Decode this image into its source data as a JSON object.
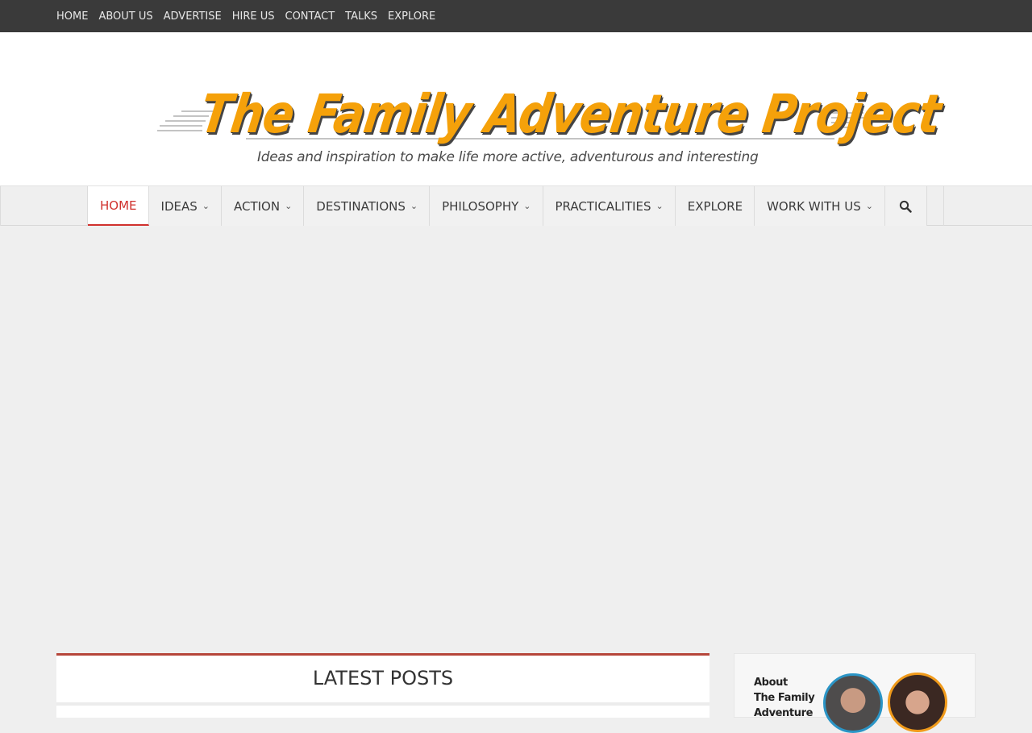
{
  "top_nav": [
    "HOME",
    "ABOUT US",
    "ADVERTISE",
    "HIRE US",
    "CONTACT",
    "TALKS",
    "EXPLORE"
  ],
  "logo": {
    "title": "The Family Adventure Project",
    "tagline": "Ideas and inspiration to make life more active, adventurous and interesting"
  },
  "main_nav": [
    {
      "label": "HOME",
      "active": true,
      "dropdown": false
    },
    {
      "label": "IDEAS",
      "active": false,
      "dropdown": true
    },
    {
      "label": "ACTION",
      "active": false,
      "dropdown": true
    },
    {
      "label": "DESTINATIONS",
      "active": false,
      "dropdown": true
    },
    {
      "label": "PHILOSOPHY",
      "active": false,
      "dropdown": true
    },
    {
      "label": "PRACTICALITIES",
      "active": false,
      "dropdown": true
    },
    {
      "label": "EXPLORE",
      "active": false,
      "dropdown": false
    },
    {
      "label": "WORK WITH US",
      "active": false,
      "dropdown": true
    }
  ],
  "search_icon": "search-icon",
  "latest_posts": {
    "title": "LATEST POSTS"
  },
  "about_widget": {
    "lines": [
      "About",
      "The Family",
      "Adventure"
    ]
  },
  "colors": {
    "topbar_bg": "#3a3a3a",
    "accent": "#d0312d",
    "logo_orange": "#f5a10a",
    "panel_border": "#b6463a"
  }
}
